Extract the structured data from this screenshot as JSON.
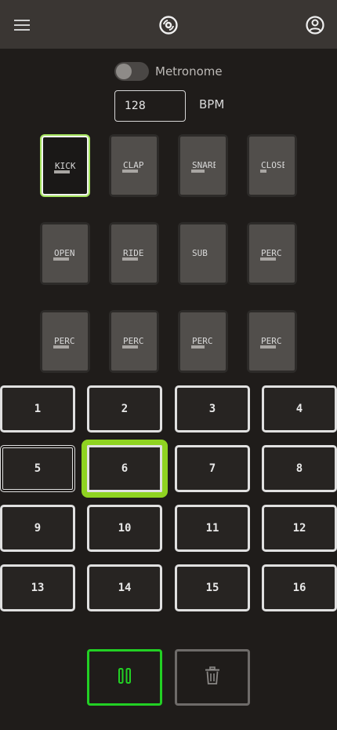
{
  "header": {
    "menu_icon": "hamburger-menu-icon",
    "logo_icon": "vinyl-record-icon",
    "account_icon": "account-circle-icon"
  },
  "metronome": {
    "label": "Metronome",
    "enabled": false
  },
  "tempo": {
    "bpm_value": "128",
    "unit_label": "BPM"
  },
  "pads": [
    {
      "label": "KICK",
      "selected": true
    },
    {
      "label": "CLAP",
      "selected": false
    },
    {
      "label": "SNARE",
      "selected": false
    },
    {
      "label": "CLOSED",
      "selected": false
    },
    {
      "label": "OPEN",
      "selected": false
    },
    {
      "label": "RIDE",
      "selected": false
    },
    {
      "label": "SUB",
      "selected": false
    },
    {
      "label": "PERC",
      "selected": false
    },
    {
      "label": "PERC",
      "selected": false
    },
    {
      "label": "PERC",
      "selected": false
    },
    {
      "label": "PERC",
      "selected": false
    },
    {
      "label": "PERC",
      "selected": false
    }
  ],
  "steps": [
    "1",
    "2",
    "3",
    "4",
    "5",
    "6",
    "7",
    "8",
    "9",
    "10",
    "11",
    "12",
    "13",
    "14",
    "15",
    "16"
  ],
  "current_step": "6",
  "controls": {
    "play_icon": "pause-icon",
    "delete_icon": "trash-icon"
  },
  "colors": {
    "accent_green": "#22d024",
    "selected_pad_border": "#a3e25c",
    "current_step_border": "#8fd321",
    "background": "#1f1c1a",
    "topbar": "#3a3633"
  }
}
